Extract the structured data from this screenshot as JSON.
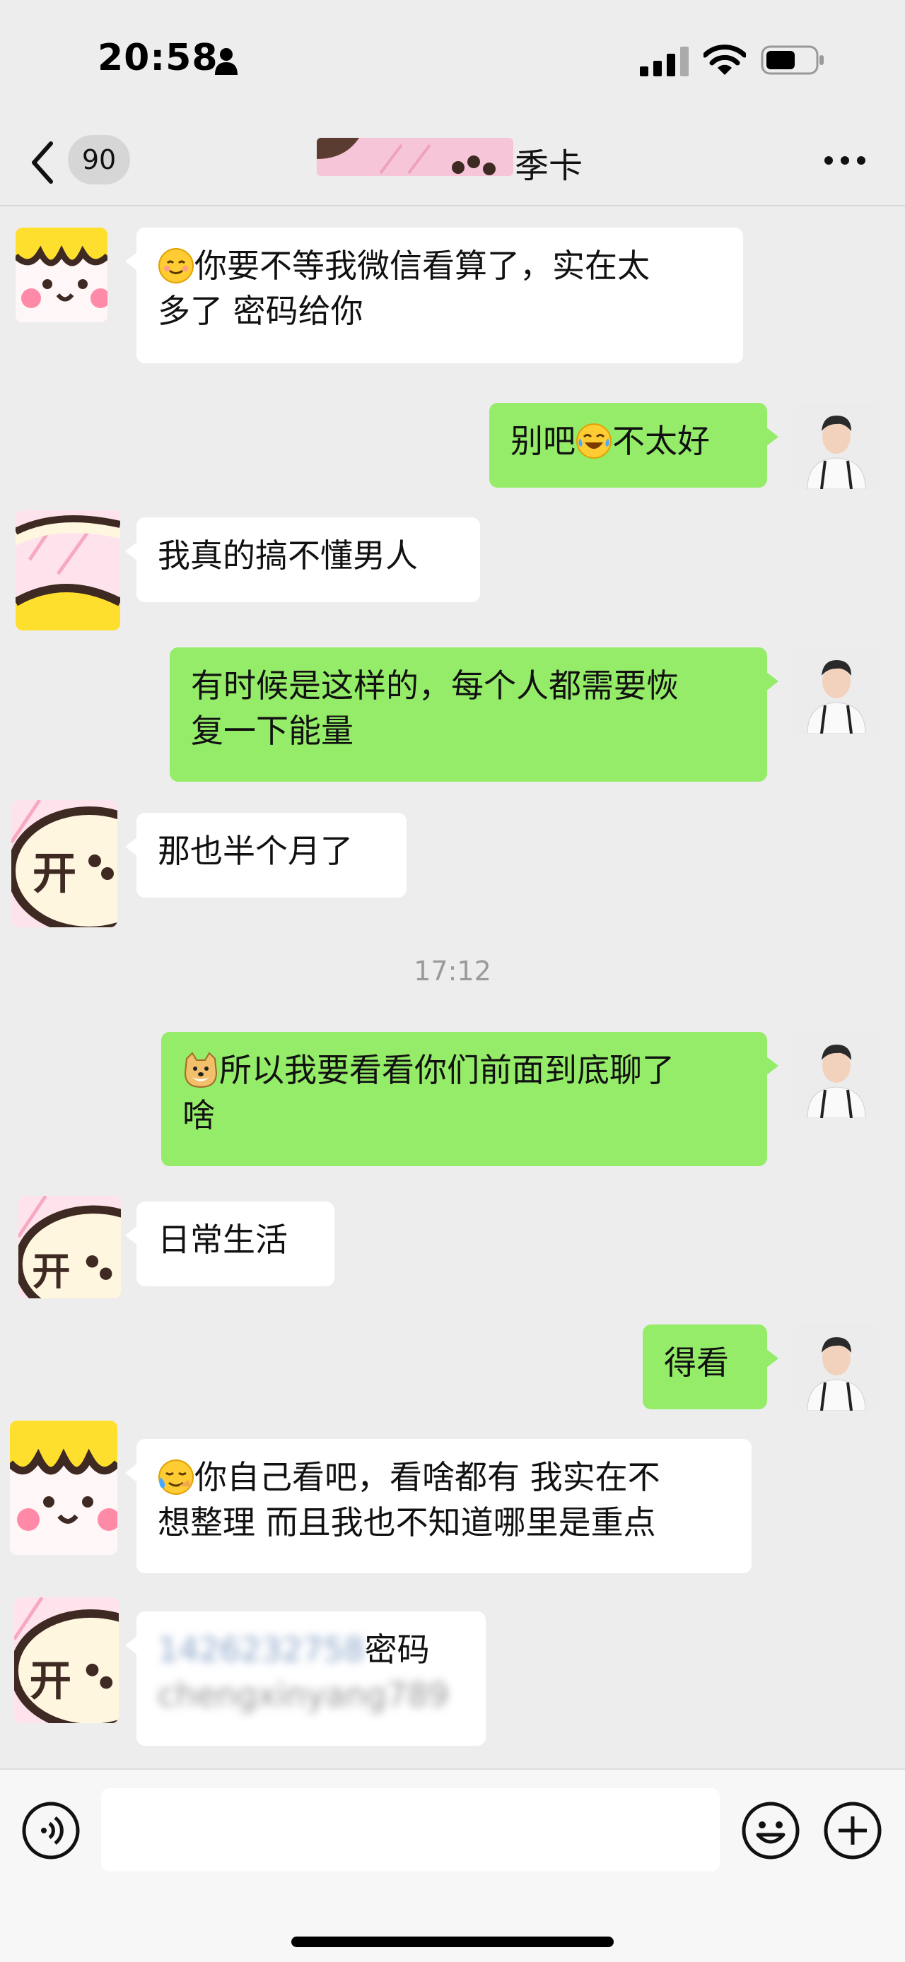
{
  "status_bar": {
    "time": "20:58"
  },
  "nav": {
    "back_count": "90",
    "contact_name": "季卡"
  },
  "messages": [
    {
      "side": "in",
      "avatar": "avatar-contact-yellow",
      "emoji": "smiling-face-emoji",
      "text": "你要不等我微信看算了，实在太",
      "text2": "多了 密码给你"
    },
    {
      "side": "out",
      "text_pre": "别吧",
      "emoji": "tears-of-joy-emoji",
      "text_post": "不太好"
    },
    {
      "side": "in",
      "text": "我真的搞不懂男人"
    },
    {
      "side": "out",
      "text": "有时候是这样的，每个人都需要恢",
      "text2": "复一下能量"
    },
    {
      "side": "in",
      "text": "那也半个月了"
    },
    {
      "side": "out",
      "emoji": "doge-emoji",
      "text": "所以我要看看你们前面到底聊了",
      "text2": "啥"
    },
    {
      "side": "in",
      "text": "日常生活"
    },
    {
      "side": "out",
      "text": "得看"
    },
    {
      "side": "in",
      "emoji": "crying-laughing-emoji",
      "text": "你自己看吧，看啥都有 我实在不",
      "text2": "想整理 而且我也不知道哪里是重点"
    },
    {
      "side": "in",
      "blur_num": "1426232758",
      "text": "密码",
      "blur_pw": "chengxinyang789"
    }
  ],
  "timestamp": "17:12",
  "colors": {
    "bg": "#ededed",
    "out_bubble": "#95ec69",
    "in_bubble": "#ffffff"
  }
}
